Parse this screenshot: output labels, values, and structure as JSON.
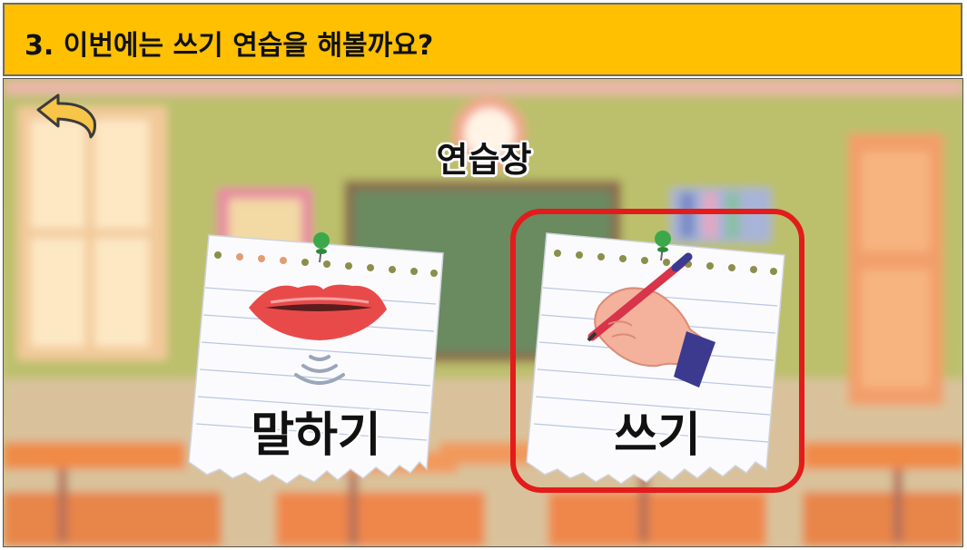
{
  "header": {
    "instruction": "3. 이번에는 쓰기 연습을 해볼까요?"
  },
  "scene": {
    "title": "연습장",
    "back_icon": "back-arrow-icon",
    "cards": [
      {
        "label": "말하기",
        "icon": "lips-sound-icon",
        "highlighted": false
      },
      {
        "label": "쓰기",
        "icon": "hand-writing-pen-icon",
        "highlighted": true
      }
    ]
  },
  "colors": {
    "header_bg": "#fec000",
    "highlight": "#e31b1b",
    "back_arrow": "#f7c548",
    "pin": "#3ca84a"
  }
}
